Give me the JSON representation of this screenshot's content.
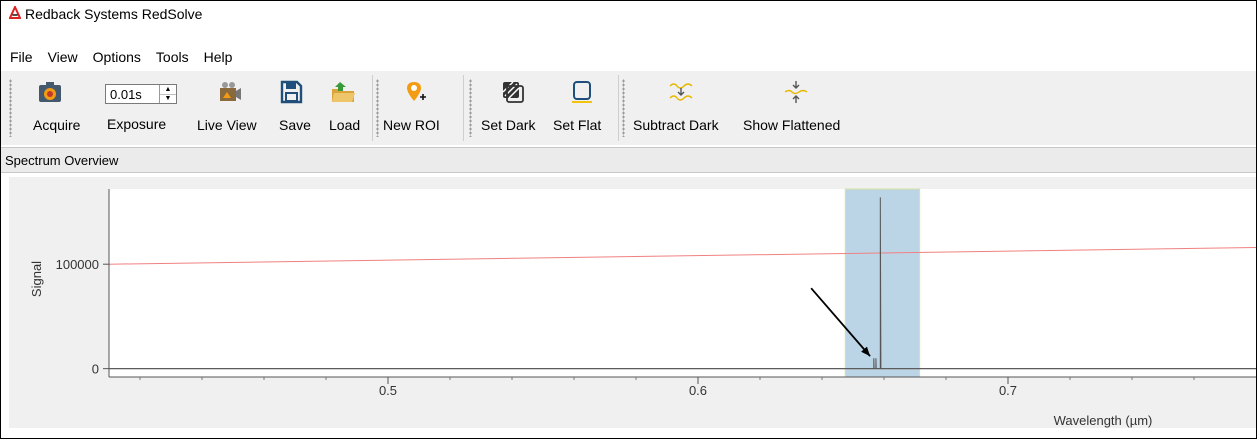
{
  "window": {
    "title": "Redback Systems RedSolve"
  },
  "menu": [
    "File",
    "View",
    "Options",
    "Tools",
    "Help"
  ],
  "toolbar": {
    "acquire": "Acquire",
    "exposure_value": "0.01s",
    "exposure_label": "Exposure",
    "live_view": "Live View",
    "save": "Save",
    "load": "Load",
    "new_roi": "New ROI",
    "set_dark": "Set Dark",
    "set_flat": "Set Flat",
    "subtract_dark": "Subtract Dark",
    "show_flattened": "Show Flattened"
  },
  "panel": {
    "title": "Spectrum Overview"
  },
  "chart_data": {
    "type": "line",
    "xlabel": "Wavelength (µm)",
    "ylabel": "Signal",
    "xlim": [
      0.41,
      0.78
    ],
    "ylim": [
      -8000,
      172000
    ],
    "x_ticks": [
      0.5,
      0.6,
      0.7
    ],
    "x_tick_labels": [
      "0.5",
      "0.6",
      "0.7"
    ],
    "y_ticks": [
      0,
      100000
    ],
    "y_tick_labels": [
      "0",
      "100000"
    ],
    "grid": false,
    "series": [
      {
        "color": "#f08080",
        "x": [
          0.41,
          0.78
        ],
        "y": [
          100000,
          116000
        ]
      },
      {
        "color": "#555555",
        "x": [
          0.41,
          0.6567,
          0.6567,
          0.6568,
          0.6574,
          0.6574,
          0.6575,
          0.6588,
          0.6588,
          0.659,
          0.78
        ],
        "y": [
          0,
          0,
          10000,
          0,
          0,
          10000,
          0,
          0,
          164000,
          0,
          0
        ]
      }
    ],
    "roi": {
      "x0": 0.6475,
      "x1": 0.6715,
      "color": "#bcd5e6"
    },
    "annotation": {
      "type": "arrow",
      "from": [
        0.6365,
        77000
      ],
      "to": [
        0.6555,
        12000
      ]
    }
  }
}
